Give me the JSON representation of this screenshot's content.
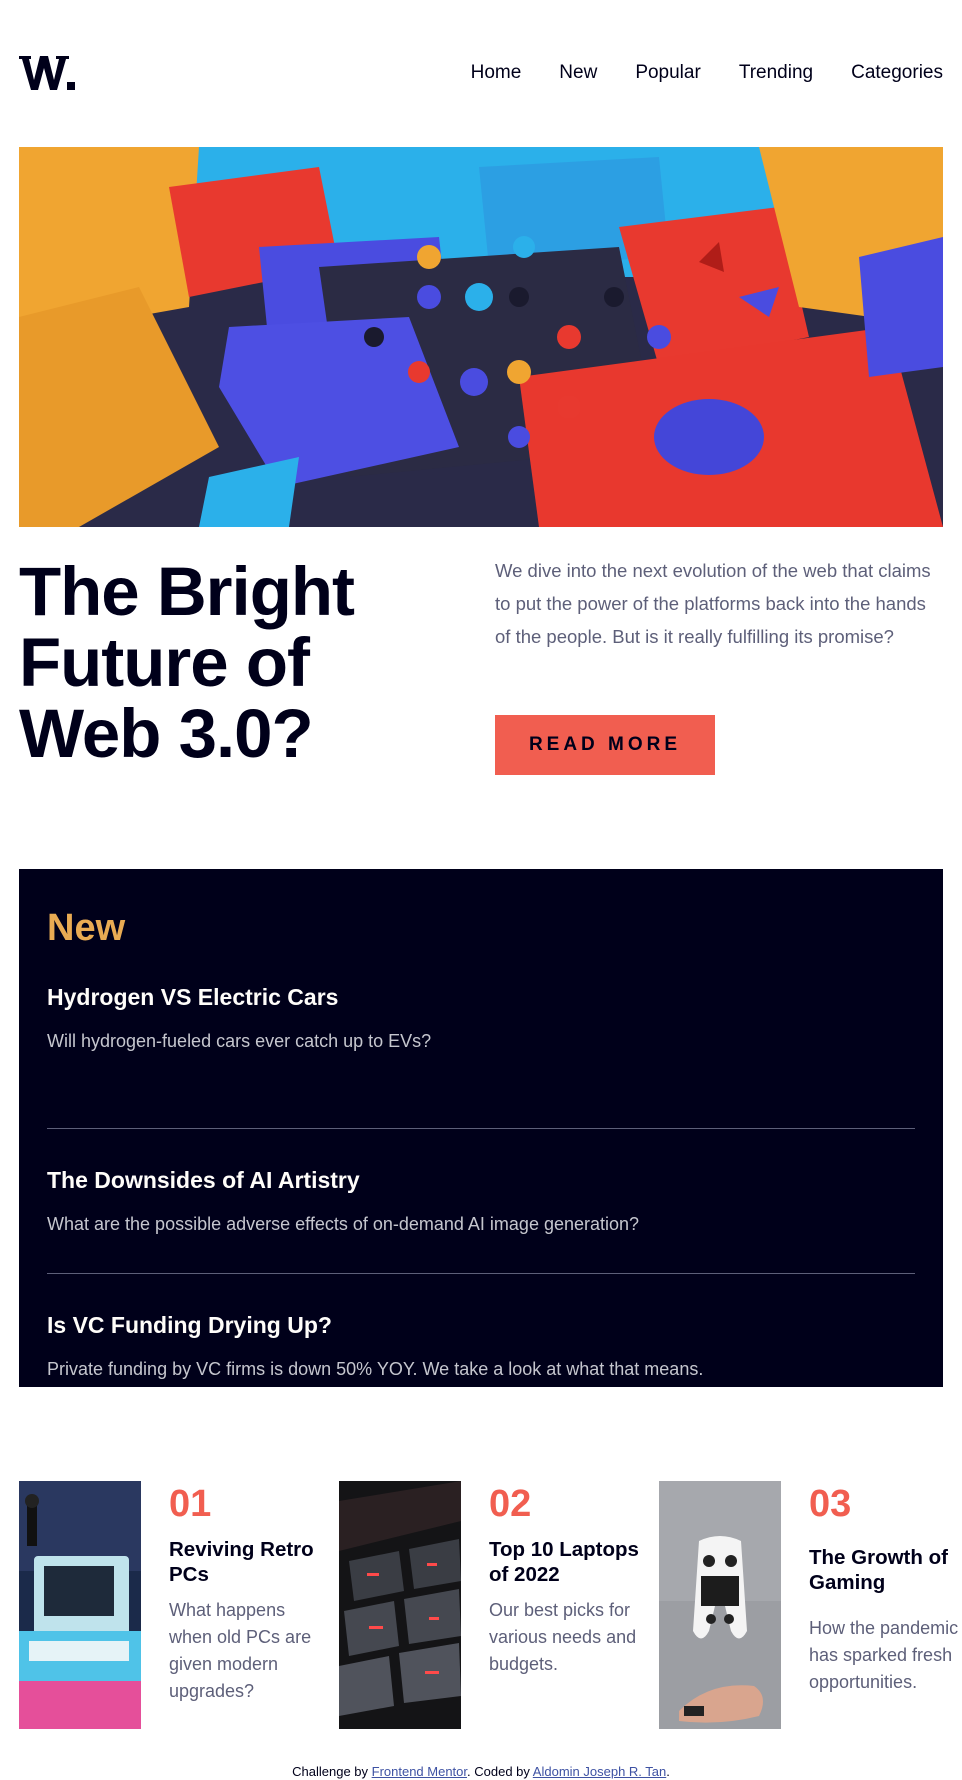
{
  "header": {
    "logo_text": "W.",
    "nav": [
      "Home",
      "New",
      "Popular",
      "Trending",
      "Categories"
    ]
  },
  "hero": {
    "title": "The Bright Future of Web 3.0?",
    "description": "We dive into the next evolution of the web that claims to put the power of the platforms back into the hands of the people. But is it really fulfilling its promise?",
    "cta": "READ MORE"
  },
  "new_section": {
    "heading": "New",
    "items": [
      {
        "title": "Hydrogen VS Electric Cars",
        "description": "Will hydrogen-fueled cars ever catch up to EVs?"
      },
      {
        "title": "The Downsides of AI Artistry",
        "description": "What are the possible adverse effects of on-demand AI image generation?"
      },
      {
        "title": "Is VC Funding Drying Up?",
        "description": "Private funding by VC firms is down 50% YOY. We take a look at what that means."
      }
    ]
  },
  "cards": [
    {
      "number": "01",
      "title": "Reviving Retro PCs",
      "description": "What happens when old PCs are given modern upgrades?"
    },
    {
      "number": "02",
      "title": "Top 10 Laptops of 2022",
      "description": "Our best picks for various needs and budgets."
    },
    {
      "number": "03",
      "title": "The Growth of Gaming",
      "description": "How the pandemic has sparked fresh opportunities."
    }
  ],
  "footer": {
    "prefix": "Challenge by ",
    "link1": "Frontend Mentor",
    "middle": ". Coded by ",
    "link2": "Aldomin Joseph R. Tan",
    "suffix": "."
  },
  "colors": {
    "dark": "#00001a",
    "accent_red": "#f15e50",
    "accent_orange": "#e9ab53",
    "muted": "#5d5f79"
  }
}
